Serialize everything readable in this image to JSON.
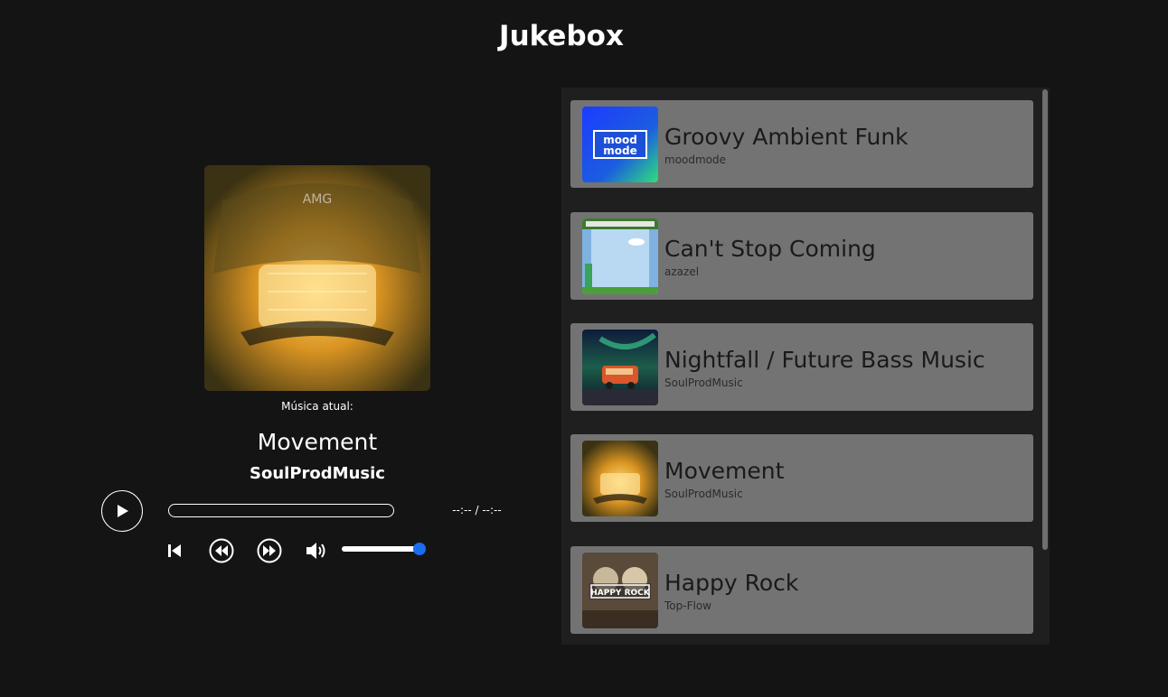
{
  "app": {
    "title": "Jukebox"
  },
  "player": {
    "now_playing_label": "Música atual:",
    "title": "Movement",
    "artist": "SoulProdMusic",
    "time_readout": "--:-- / --:--",
    "progress_percent": 0,
    "volume_percent": 100,
    "cover_icon": "car-engine-artwork",
    "controls": {
      "play": "play-icon",
      "previous": "skip-previous-icon",
      "rewind": "rewind-icon",
      "forward": "fast-forward-icon",
      "volume": "volume-icon"
    },
    "colors": {
      "accent": "#1a6cf0"
    }
  },
  "playlist": {
    "tracks": [
      {
        "title": "Groovy Ambient Funk",
        "artist": "moodmode",
        "thumb_text": "mood mode"
      },
      {
        "title": "Can't Stop Coming",
        "artist": "azazel",
        "thumb_text": ""
      },
      {
        "title": "Nightfall / Future Bass Music",
        "artist": "SoulProdMusic",
        "thumb_text": ""
      },
      {
        "title": "Movement",
        "artist": "SoulProdMusic",
        "thumb_text": ""
      },
      {
        "title": "Happy Rock",
        "artist": "Top-Flow",
        "thumb_text": "HAPPY ROCK"
      }
    ]
  }
}
